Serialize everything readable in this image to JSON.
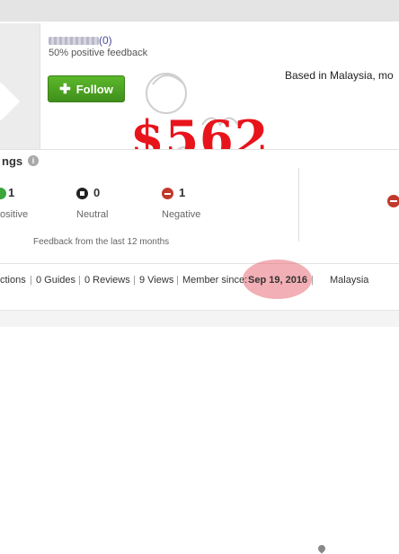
{
  "profile": {
    "feedback_count": "(0)",
    "positive_feedback": "50% positive feedback",
    "follow_label": "Follow",
    "location": "Based in Malaysia, mo"
  },
  "overlay": {
    "price": "$562"
  },
  "ratings": {
    "title": "ngs",
    "positive": {
      "count": "1",
      "label": "ositive"
    },
    "neutral": {
      "count": "0",
      "label": "Neutral"
    },
    "negative": {
      "count": "1",
      "label": "Negative"
    },
    "period_note": "Feedback from the last 12 months"
  },
  "stats": {
    "collections": "ctions",
    "guides": "0 Guides",
    "reviews": "0 Reviews",
    "views": "9 Views",
    "member_since_label": "Member since:",
    "member_since_date": "Sep 19, 2016",
    "country": "Malaysia"
  },
  "colors": {
    "follow_green": "#4aa523",
    "price_red": "#e8141c",
    "highlight": "#e86e78"
  }
}
